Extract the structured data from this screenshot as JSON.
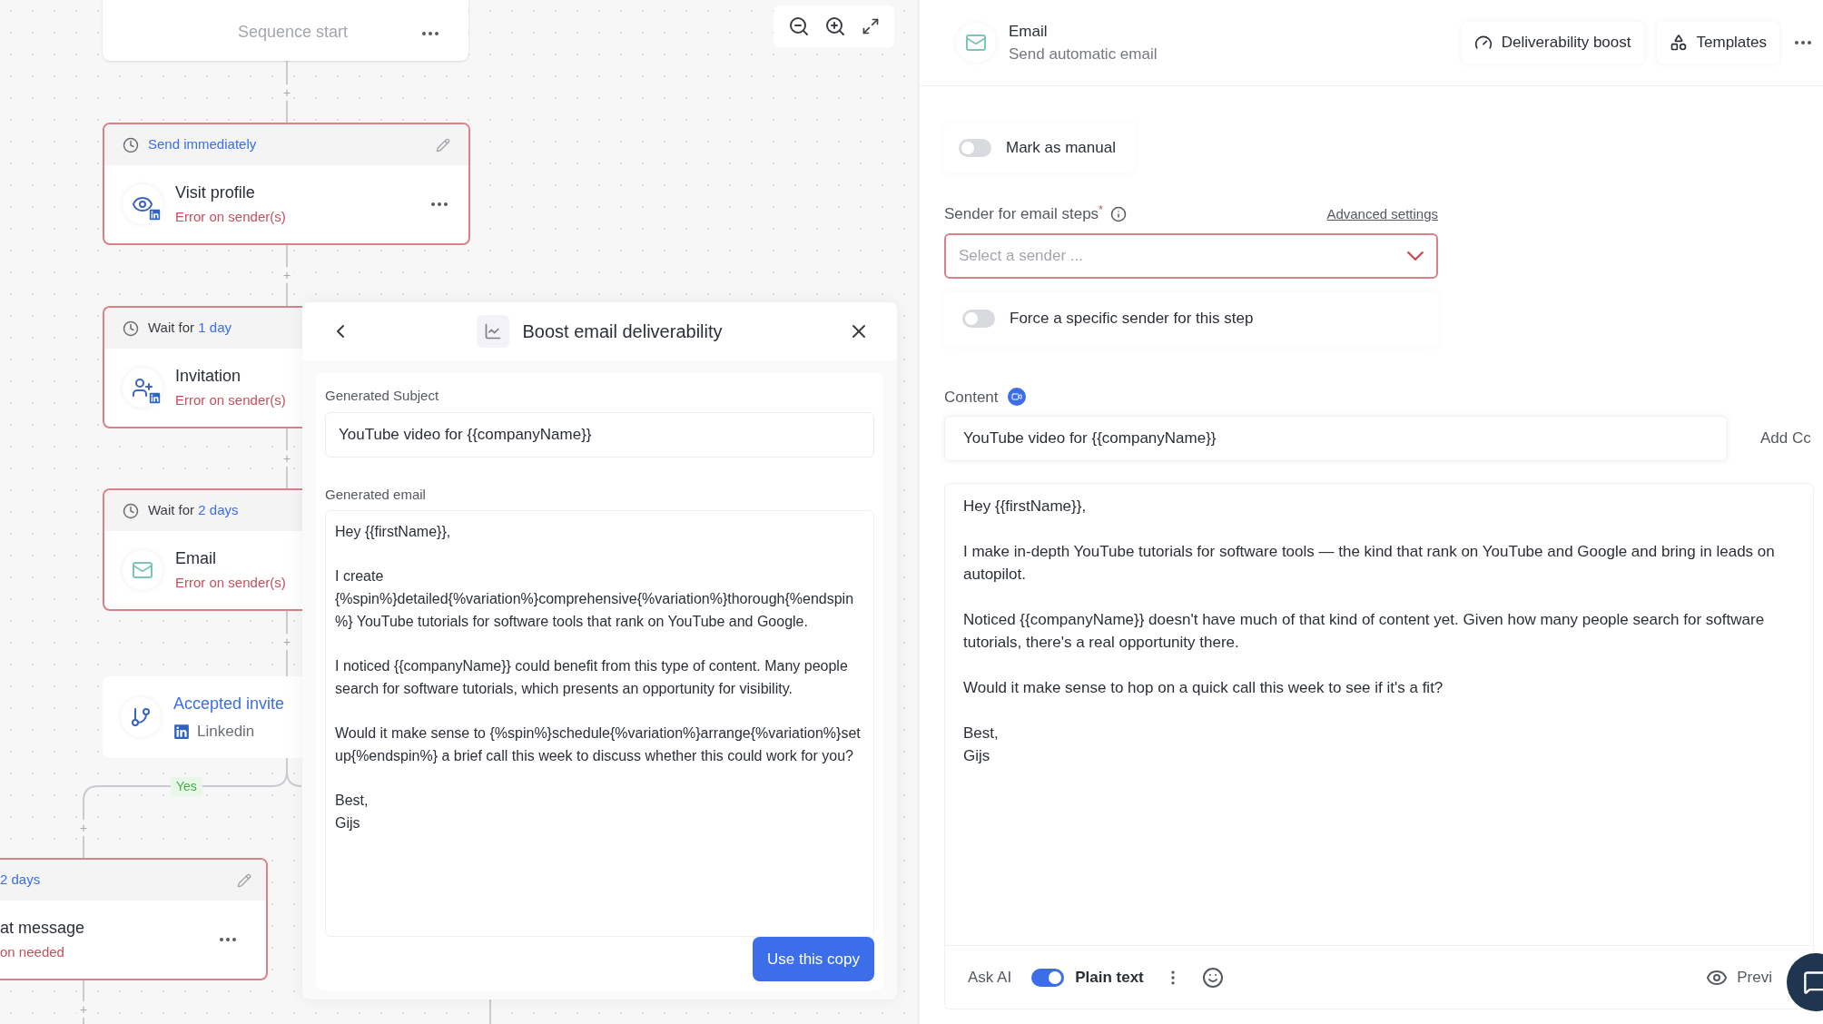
{
  "canvas": {
    "start_node": {
      "label": "Sequence start"
    },
    "steps": [
      {
        "kind": "visit",
        "timing_value": "Send immediately",
        "title": "Visit profile",
        "status": "Error on sender(s)",
        "error": true,
        "linkedin_badge": true,
        "editable": true,
        "clipped": false
      },
      {
        "kind": "invite",
        "timing_prefix": "Wait for",
        "timing_value": "1 day",
        "title": "Invitation",
        "status": "Error on sender(s)",
        "error": true,
        "linkedin_badge": true,
        "editable": false,
        "clipped": true
      },
      {
        "kind": "email",
        "timing_prefix": "Wait for",
        "timing_value": "2 days",
        "title": "Email",
        "status": "Error on sender(s)",
        "error": true,
        "linkedin_badge": false,
        "editable": false,
        "clipped": true
      }
    ],
    "condition": {
      "title": "Accepted invite",
      "channel": "Linkedin"
    },
    "branch_label": "Yes",
    "bottom_step": {
      "timing_value": "2 days",
      "title": "at message",
      "status": "on needed",
      "error": true
    },
    "add_buttons": [
      "+",
      "+",
      "+",
      "+",
      "+",
      "+"
    ]
  },
  "boost_dialog": {
    "title": "Boost email deliverability",
    "subject_label": "Generated Subject",
    "subject": "YouTube video for {{companyName}}",
    "email_label": "Generated email",
    "email_body": [
      "Hey {{firstName}},",
      "I create {%spin%}detailed{%variation%}comprehensive{%variation%}thorough{%endspin%} YouTube tutorials for software tools that rank on YouTube and Google.",
      "I noticed {{companyName}} could benefit from this type of content. Many people search for software tutorials, which presents an opportunity for visibility.",
      "Would it make sense to {%spin%}schedule{%variation%}arrange{%variation%}set up{%endspin%} a brief call this week to discuss whether this could work for you?",
      "Best,\nGijs"
    ],
    "button": "Use this copy"
  },
  "editor": {
    "title": "Email",
    "subtitle": "Send automatic email",
    "header_buttons": [
      {
        "kind": "gauge",
        "label": "Deliverability boost"
      },
      {
        "kind": "shapes",
        "label": "Templates"
      }
    ],
    "mark_manual": {
      "label": "Mark as manual",
      "on": false
    },
    "sender": {
      "label": "Sender for email steps",
      "required_mark": "*",
      "link": "Advanced settings",
      "placeholder": "Select a sender ...",
      "error": true
    },
    "force_sender": {
      "label": "Force a specific sender for this step",
      "on": false
    },
    "content": {
      "label": "Content",
      "subject": "YouTube video for {{companyName}}",
      "add_cc": "Add Cc",
      "body": [
        "Hey {{firstName}},",
        "I make in-depth YouTube tutorials for software tools — the kind that rank on YouTube and Google and bring in leads on autopilot.",
        "Noticed {{companyName}} doesn't have much of that kind of content yet. Given how many people search for software tutorials, there's a real opportunity there.",
        "Would it make sense to hop on a quick call this week to see if it's a fit?",
        "Best,\nGijs"
      ]
    },
    "toolbar": {
      "ask_ai": "Ask AI",
      "plain_text": {
        "label": "Plain text",
        "on": true
      },
      "preview": "Previ"
    }
  }
}
